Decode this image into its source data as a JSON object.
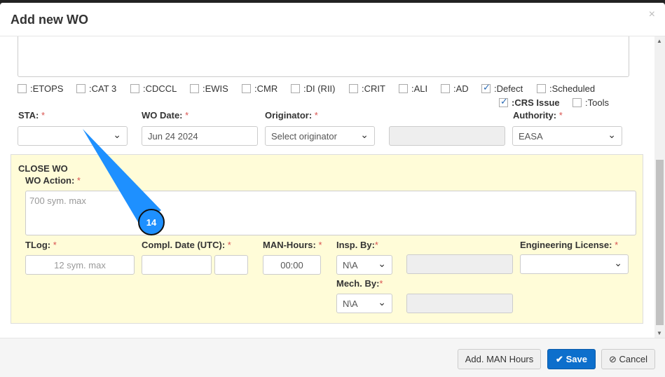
{
  "modal": {
    "title": "Add new WO",
    "close": "×"
  },
  "flags": [
    {
      "label": ":ETOPS",
      "checked": false
    },
    {
      "label": ":CAT 3",
      "checked": false
    },
    {
      "label": ":CDCCL",
      "checked": false
    },
    {
      "label": ":EWIS",
      "checked": false
    },
    {
      "label": ":CMR",
      "checked": false
    },
    {
      "label": ":DI (RII)",
      "checked": false
    },
    {
      "label": ":CRIT",
      "checked": false
    },
    {
      "label": ":ALI",
      "checked": false
    },
    {
      "label": ":AD",
      "checked": false
    },
    {
      "label": ":Defect",
      "checked": true
    },
    {
      "label": ":Scheduled",
      "checked": false
    },
    {
      "label": ":CRS Issue",
      "checked": true
    },
    {
      "label": ":Tools",
      "checked": false
    }
  ],
  "form": {
    "sta_label": "STA:",
    "sta_value": "",
    "wo_date_label": "WO Date:",
    "wo_date_value": "Jun 24 2024",
    "originator_label": "Originator:",
    "originator_value": "Select originator",
    "authority_label": "Authority:",
    "authority_value": "EASA",
    "required": "*"
  },
  "close_wo": {
    "heading": "CLOSE WO",
    "action_label": "WO Action:",
    "action_placeholder": "700 sym. max",
    "tlog_label": "TLog:",
    "tlog_placeholder": "12 sym. max",
    "compl_label": "Compl. Date (UTC):",
    "man_hours_label": "MAN-Hours:",
    "man_hours_value": "00:00",
    "insp_label": "Insp. By:",
    "insp_value": "N\\A",
    "mech_label": "Mech. By:",
    "mech_value": "N\\A",
    "eng_label": "Engineering License:"
  },
  "footer": {
    "add_hours": "Add. MAN Hours",
    "save": "Save",
    "cancel": "Cancel",
    "save_icon": "✔",
    "cancel_icon": "⊘"
  },
  "callout": {
    "number": "14",
    "color": "#1e90ff"
  }
}
